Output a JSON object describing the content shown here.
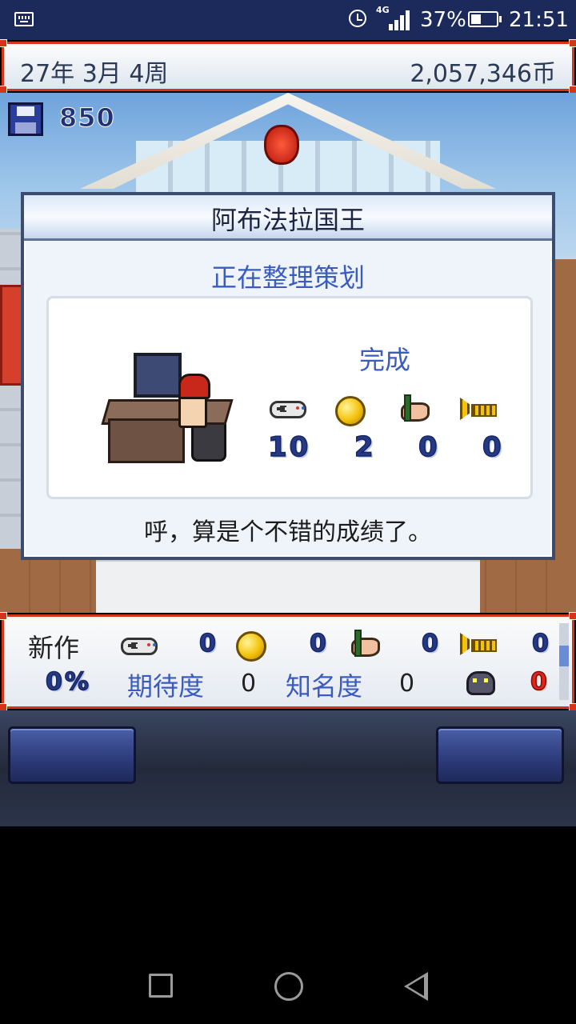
{
  "status_bar": {
    "network": "4G",
    "battery_percent": "37%",
    "time": "21:51"
  },
  "top_bar": {
    "date": "27年 3月 4周",
    "money": "2,057,346币"
  },
  "scene": {
    "save_points": "850"
  },
  "dialog": {
    "title": "阿布法拉国王",
    "status": "正在整理策划",
    "complete_label": "完成",
    "stats": {
      "fun": "10",
      "creativity": "2",
      "graphics": "0",
      "sound": "0"
    },
    "message": "呼，算是个不错的成绩了。"
  },
  "bottom_panel": {
    "title": "新作",
    "fun": "0",
    "creativity": "0",
    "graphics": "0",
    "sound": "0",
    "progress": "0%",
    "expectation_label": "期待度",
    "expectation_value": "0",
    "fame_label": "知名度",
    "fame_value": "0",
    "bugs": "0"
  },
  "icons": [
    "keyboard-icon",
    "alarm-icon",
    "signal-icon",
    "battery-icon",
    "save-icon",
    "gamepad-icon",
    "coin-icon",
    "paint-icon",
    "trumpet-icon",
    "bug-monster-icon",
    "nav-recent-icon",
    "nav-home-icon",
    "nav-back-icon"
  ],
  "colors": {
    "frame_red": "#d63318",
    "accent_blue": "#3a5cbf",
    "status_bar": "#1b2a5a"
  }
}
